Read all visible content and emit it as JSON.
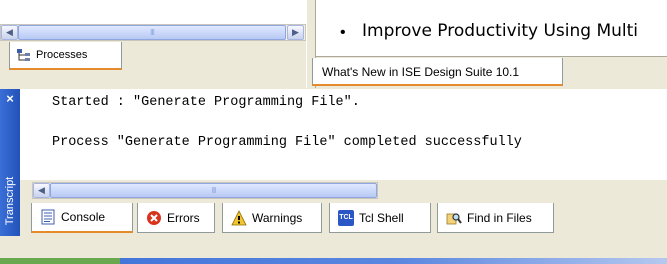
{
  "processes_pane": {
    "tab_label": "Processes",
    "scroll_thumb_grip": "III"
  },
  "doc_pane": {
    "bullet": "•",
    "text": "Improve Productivity Using Multi",
    "tab_label": "What's New in ISE Design Suite 10.1"
  },
  "transcript": {
    "side_label": "Transcript",
    "close_glyph": "×",
    "lines": [
      "Started : \"Generate Programming File\".",
      "Process \"Generate Programming File\" completed successfully"
    ],
    "scroll_thumb_grip": "III"
  },
  "bottom_tabs": [
    {
      "label": "Console",
      "icon": "console-icon",
      "active": true
    },
    {
      "label": "Errors",
      "icon": "errors-icon",
      "active": false
    },
    {
      "label": "Warnings",
      "icon": "warnings-icon",
      "active": false
    },
    {
      "label": "Tcl Shell",
      "icon": "tcl-shell-icon",
      "icon_text": "TCL",
      "active": false
    },
    {
      "label": "Find in Files",
      "icon": "find-in-files-icon",
      "active": false
    }
  ],
  "colors": {
    "panel_bg": "#ece9d8",
    "active_tab_accent": "#e68b2c",
    "transcript_bar": "#2f62c9",
    "error_red": "#d7341f",
    "warning_yellow": "#f2c530"
  }
}
